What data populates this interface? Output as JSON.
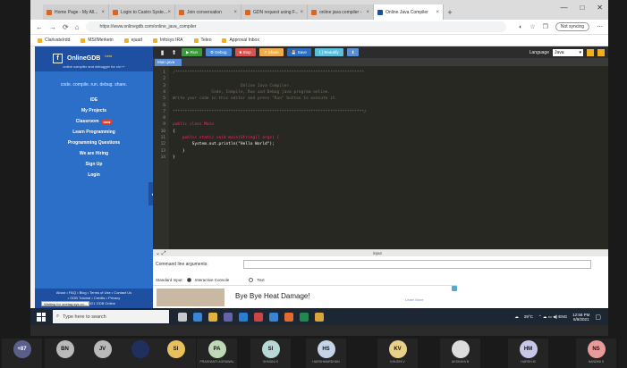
{
  "browser": {
    "tabs": [
      {
        "label": "Home Page - My All..."
      },
      {
        "label": "Login to Castro Syste..."
      },
      {
        "label": "Join conversation"
      },
      {
        "label": "GDN request using F..."
      },
      {
        "label": "online java compiler -"
      },
      {
        "label": "Online Java Compiler"
      }
    ],
    "new_tab": "+",
    "window_controls": [
      "—",
      "□",
      "✕"
    ],
    "url": "https://www.onlinegdb.com/online_java_compiler",
    "not_syncing": "Not syncing",
    "bookmarks": [
      "Clarivate/rdd",
      "MS/IMerketn",
      "ejuad",
      "Infosys IRA",
      "Teleo",
      "Approval Inbox"
    ]
  },
  "sidebar": {
    "logo_text": "OnlineGDB",
    "logo_beta": "beta",
    "logo_sub": "online compiler and debugger for c/c++",
    "tagline": "code. compile. run. debug. share.",
    "items": [
      {
        "label": "IDE"
      },
      {
        "label": "My Projects"
      },
      {
        "label": "Classroom",
        "badge": "new"
      },
      {
        "label": "Learn Programming"
      },
      {
        "label": "Programming Questions"
      },
      {
        "label": "We are Hiring"
      },
      {
        "label": "Sign Up"
      },
      {
        "label": "Login"
      }
    ],
    "footer": [
      "About • FAQ • Blog • Terms of Use • Contact Us",
      "• GDB Tutorial • Credits • Privacy",
      "© 2016 - 2021 GDB Online"
    ],
    "collapse_icon": "‹"
  },
  "toolbar": {
    "buttons": [
      {
        "label": "▶ Run",
        "color": "#3d9b3d"
      },
      {
        "label": "⚙ Debug",
        "color": "#4a88d8"
      },
      {
        "label": "■ Stop",
        "color": "#d9534f"
      },
      {
        "label": "↗ Share",
        "color": "#f0ad4e"
      },
      {
        "label": "💾 Save",
        "color": "#2a6fc4"
      },
      {
        "label": "{ } Beautify",
        "color": "#5bc0de"
      },
      {
        "label": "⬇",
        "color": "#5a8fd6"
      }
    ],
    "language_label": "Language",
    "language_value": "Java"
  },
  "file_tab": "Main.java",
  "editor": {
    "lines": [
      {
        "n": "1",
        "text": "/******************************************************************************",
        "cls": "cm"
      },
      {
        "n": "2",
        "text": "",
        "cls": "cm"
      },
      {
        "n": "3",
        "text": "                            Online Java Compiler.",
        "cls": "cm"
      },
      {
        "n": "4",
        "text": "                Code, Compile, Run and Debug java program online.",
        "cls": "cm"
      },
      {
        "n": "5",
        "text": "Write your code in this editor and press \"Run\" button to execute it.",
        "cls": "cm"
      },
      {
        "n": "6",
        "text": "",
        "cls": "cm"
      },
      {
        "n": "7",
        "text": "*******************************************************************************/",
        "cls": "cm"
      },
      {
        "n": "8",
        "text": "",
        "cls": "pl"
      },
      {
        "n": "9",
        "text": "public class Main",
        "cls": "kw"
      },
      {
        "n": "10",
        "text": "{",
        "cls": "pl"
      },
      {
        "n": "11",
        "text": "    public static void main(String[] args) {",
        "cls": "kw"
      },
      {
        "n": "12",
        "text": "        System.out.println(\"Hello World\");",
        "cls": "pl"
      },
      {
        "n": "13",
        "text": "    }",
        "cls": "pl"
      },
      {
        "n": "14",
        "text": "}",
        "cls": "pl"
      }
    ]
  },
  "io": {
    "header": "input",
    "cmd_label": "Command line arguments:",
    "stdin_label": "Standard Input:",
    "option_interactive": "Interactive Console",
    "option_text": "Text",
    "ad_text": "Bye Bye Heat Damage!",
    "ad_more": "Learn More"
  },
  "taskbar": {
    "search_placeholder": "Type here to search",
    "tooltip": "Waiting for onetag.sys.co...",
    "temp": "29°C",
    "time": "12:58 PM",
    "date": "6/8/2021"
  },
  "meeting": {
    "participants": [
      {
        "initials": "+87",
        "color": "#5a5f8a",
        "name": ""
      },
      {
        "initials": "BN",
        "color": "#b9b9b9",
        "name": ""
      },
      {
        "initials": "JV",
        "color": "#b9b9b9",
        "name": ""
      },
      {
        "initials": "",
        "color": "#1f2f5e",
        "name": ""
      },
      {
        "initials": "SI",
        "color": "#e9c15c",
        "name": ""
      },
      {
        "initials": "PA",
        "color": "#bfd8b8",
        "name": "PRASHANTI AGRAWAL"
      },
      {
        "initials": "SI",
        "color": "#b8d8d6",
        "name": "SHIVANI S"
      },
      {
        "initials": "HS",
        "color": "#c6d4ea",
        "name": "HARSHWARDHAN"
      },
      {
        "initials": "KV",
        "color": "#e9d08a",
        "name": "KHUSHI V"
      },
      {
        "initials": "",
        "color": "#dcdcdc",
        "name": "AKSHAYA B"
      },
      {
        "initials": "HM",
        "color": "#c9c7e9",
        "name": "HARSH M"
      },
      {
        "initials": "NS",
        "color": "#e99a9a",
        "name": "NANDINI S"
      }
    ]
  }
}
